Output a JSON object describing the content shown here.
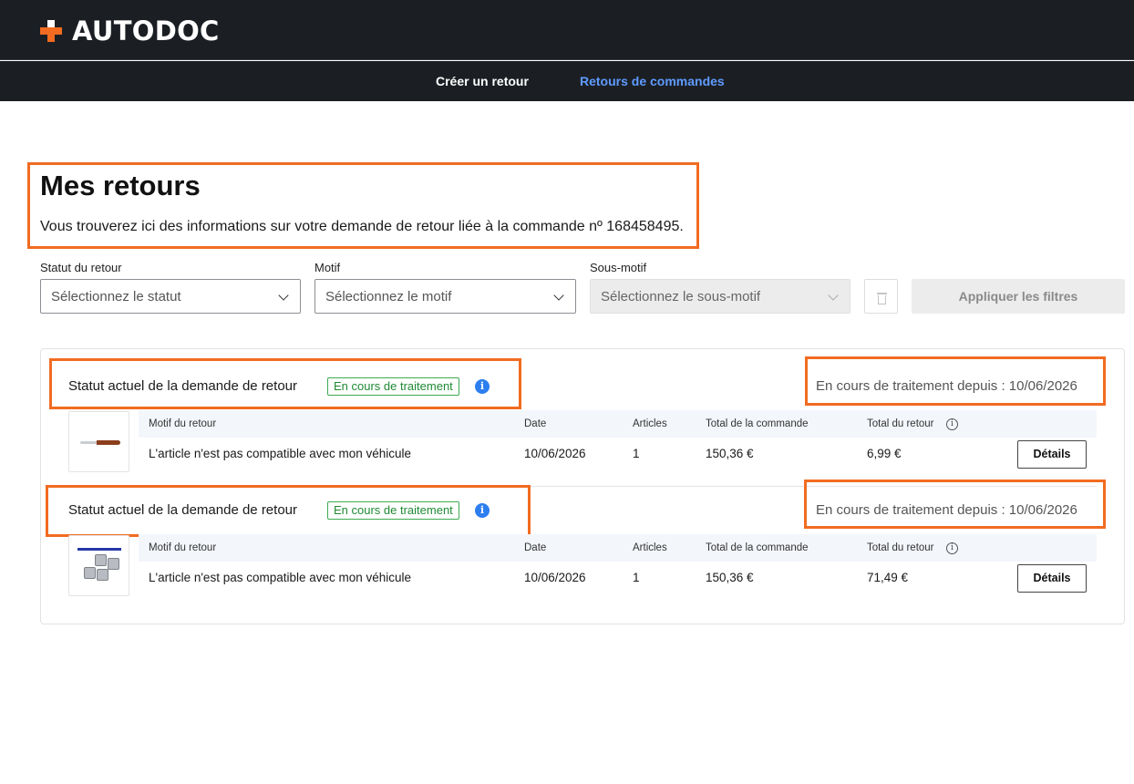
{
  "header": {
    "logo_text": "AUTODOC",
    "nav": [
      {
        "label": "Créer un retour",
        "active": false
      },
      {
        "label": "Retours de commandes",
        "active": true
      }
    ]
  },
  "page": {
    "title": "Mes retours",
    "subtitle": "Vous trouverez ici des informations sur votre demande de retour liée à la commande nº 168458495."
  },
  "filters": {
    "status": {
      "label": "Statut du retour",
      "placeholder": "Sélectionnez le statut"
    },
    "reason": {
      "label": "Motif",
      "placeholder": "Sélectionnez le motif"
    },
    "subreason": {
      "label": "Sous-motif",
      "placeholder": "Sélectionnez le sous-motif",
      "disabled": true
    },
    "apply_label": "Appliquer les filtres"
  },
  "columns": {
    "reason": "Motif du retour",
    "date": "Date",
    "articles": "Articles",
    "order_total": "Total de la commande",
    "return_total": "Total du retour"
  },
  "returns": [
    {
      "status_label": "Statut actuel de la demande de retour",
      "status_badge": "En cours de traitement",
      "since": "En cours de traitement depuis : 10/06/2026",
      "product_image": "knife-icon",
      "reason": "L'article n'est pas compatible avec mon véhicule",
      "date": "10/06/2026",
      "articles": "1",
      "order_total": "150,36 €",
      "return_total": "6,99 €",
      "details_label": "Détails"
    },
    {
      "status_label": "Statut actuel de la demande de retour",
      "status_badge": "En cours de traitement",
      "since": "En cours de traitement depuis : 10/06/2026",
      "product_image": "clips-icon",
      "reason": "L'article n'est pas compatible avec mon véhicule",
      "date": "10/06/2026",
      "articles": "1",
      "order_total": "150,36 €",
      "return_total": "71,49 €",
      "details_label": "Détails"
    }
  ],
  "colors": {
    "header_bg": "#1b1f24",
    "brand_orange": "#f26b21",
    "active_nav": "#5f9bff",
    "badge_green": "#3cab50",
    "info_blue": "#2d7ff0"
  }
}
